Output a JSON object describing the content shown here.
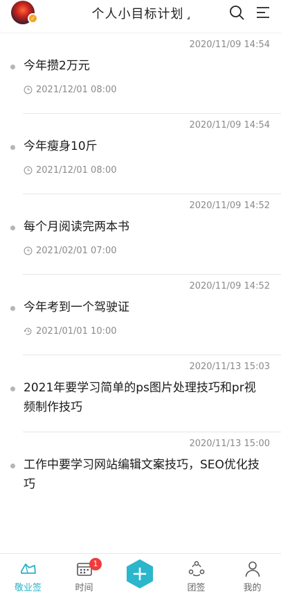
{
  "header": {
    "title": "个人小目标计划"
  },
  "tasks": [
    {
      "created": "2020/11/09 14:54",
      "title": "今年攒2万元",
      "due": "2021/12/01 08:00",
      "due_icon": "clock-icon"
    },
    {
      "created": "2020/11/09 14:54",
      "title": "今年瘦身10斤",
      "due": "2021/12/01 08:00",
      "due_icon": "clock-icon"
    },
    {
      "created": "2020/11/09 14:52",
      "title": "每个月阅读完两本书",
      "due": "2021/02/01 07:00",
      "due_icon": "clock-icon"
    },
    {
      "created": "2020/11/09 14:52",
      "title": "今年考到一个驾驶证",
      "due": "2021/01/01 10:00",
      "due_icon": "repeat-clock-icon"
    },
    {
      "created": "2020/11/13 15:03",
      "title": "2021年要学习简单的ps图片处理技巧和pr视频制作技巧",
      "due": "",
      "due_icon": ""
    },
    {
      "created": "2020/11/13 15:00",
      "title": "工作中要学习网站编辑文案技巧，SEO优化技巧",
      "due": "",
      "due_icon": ""
    }
  ],
  "tabbar": {
    "tabs": [
      {
        "label": "敬业签",
        "icon": "note-icon",
        "active": true
      },
      {
        "label": "时间",
        "icon": "calendar-icon",
        "badge": "1"
      },
      {
        "label": "",
        "icon": "add-icon"
      },
      {
        "label": "团签",
        "icon": "team-icon"
      },
      {
        "label": "我的",
        "icon": "user-icon"
      }
    ]
  },
  "colors": {
    "accent": "#29b3c8",
    "badge": "#ee3c3c",
    "muted_text": "#8a8a8a"
  }
}
